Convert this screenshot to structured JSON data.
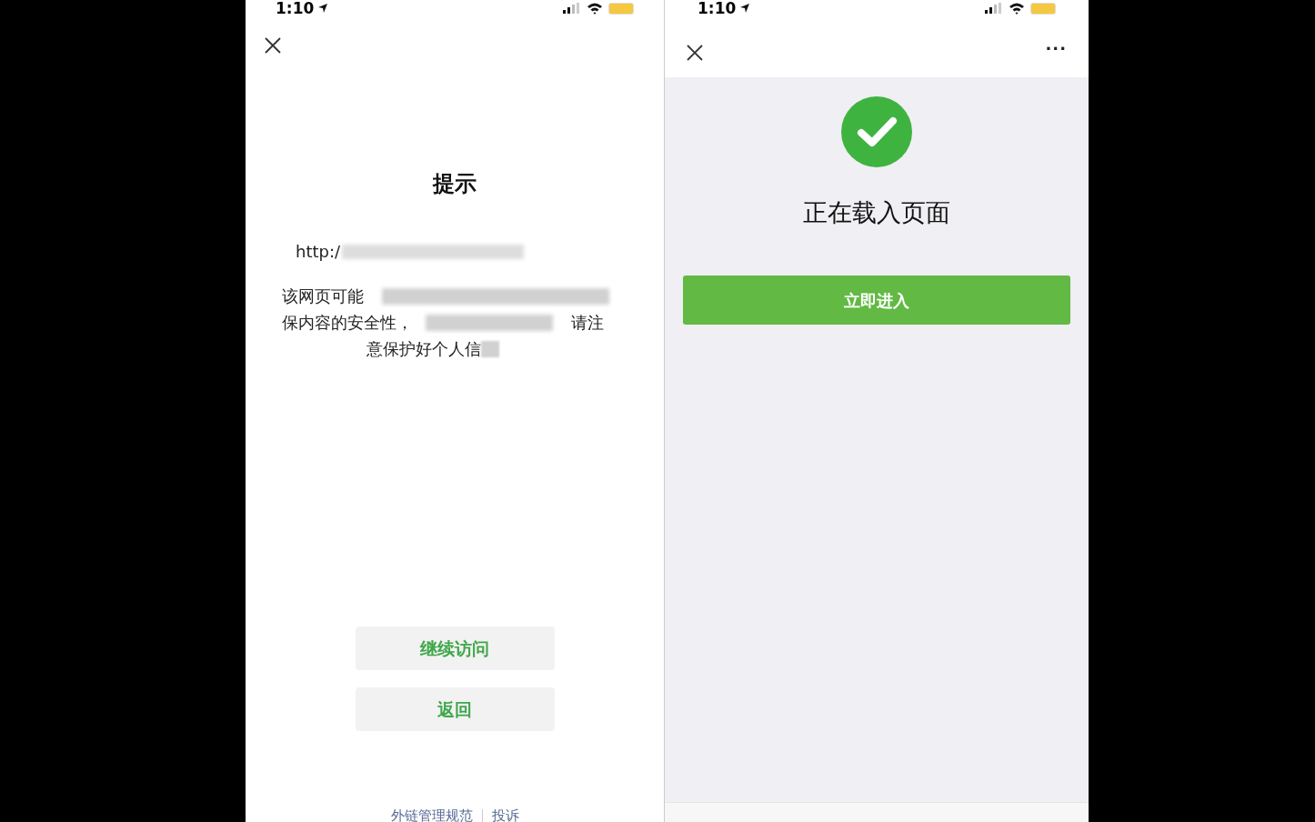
{
  "left_screen": {
    "status_bar": {
      "time": "1:10"
    },
    "title": "提示",
    "url": "http:/",
    "message_lines": [
      "该网页可能",
      "保内容的安全性，",
      "请注",
      "意保护好个人信"
    ],
    "buttons": [
      "继续访问",
      "返回"
    ],
    "footer_links": [
      "外链管理规范",
      "投诉"
    ]
  },
  "right_screen": {
    "status_bar": {
      "time": "1:10"
    },
    "menu": "···",
    "status_text": "正在载入页面",
    "button": "立即进入"
  }
}
